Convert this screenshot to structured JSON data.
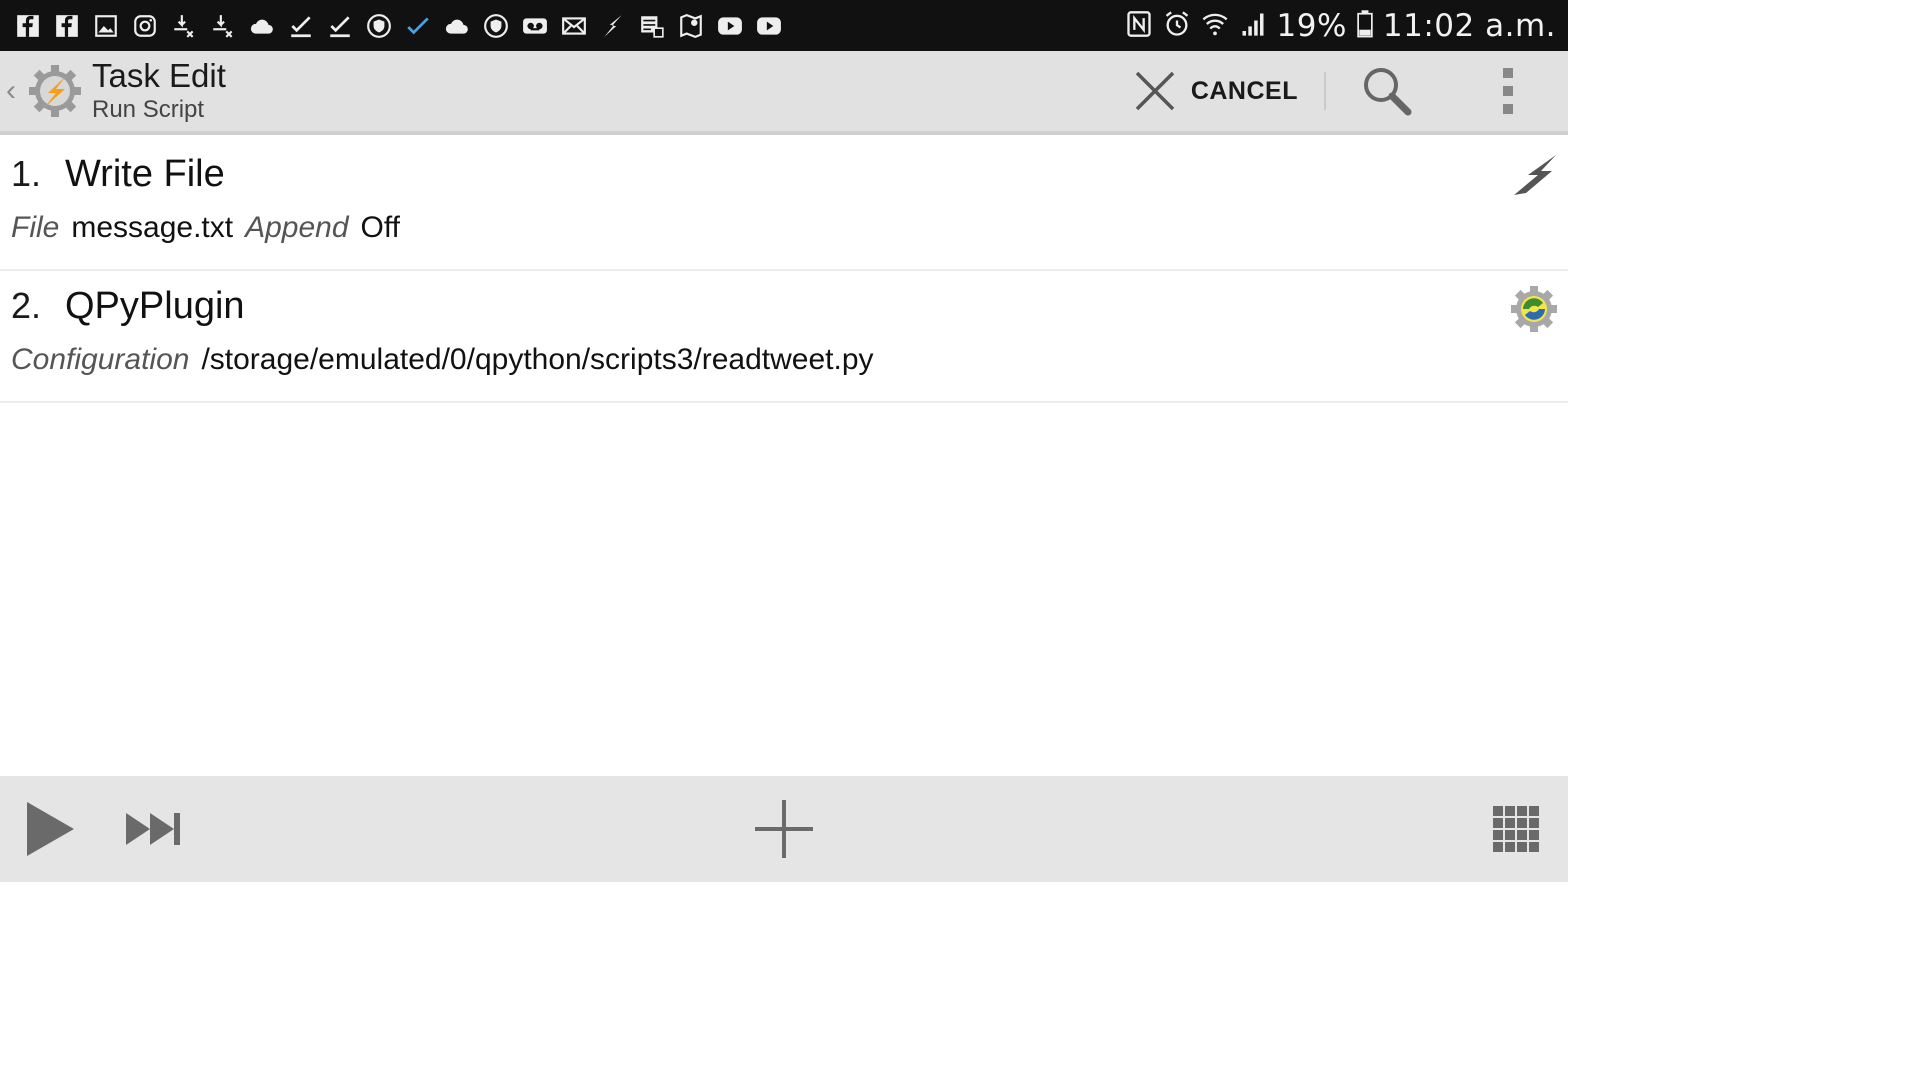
{
  "status_bar": {
    "notification_icons": [
      "facebook-icon",
      "facebook-icon",
      "gallery-icon",
      "instagram-icon",
      "download-done-icon",
      "download-done-icon",
      "cloud-icon",
      "checkmark-icon",
      "checkmark-icon",
      "shield-icon",
      "check-blue-icon",
      "cloud-icon",
      "shield-icon",
      "voicemail-icon",
      "mail-icon",
      "tasker-bolt-icon",
      "news-icon",
      "map-icon",
      "youtube-icon",
      "youtube-icon"
    ],
    "battery": "19%",
    "time": "11:02 a.m."
  },
  "app_bar": {
    "title": "Task Edit",
    "subtitle": "Run Script",
    "cancel_label": "CANCEL"
  },
  "actions": [
    {
      "number": "1.",
      "name": "Write File",
      "params": [
        {
          "key": "File",
          "value": "message.txt"
        },
        {
          "key": "Append",
          "value": "Off"
        }
      ],
      "icon": "tasker-bolt-icon"
    },
    {
      "number": "2.",
      "name": "QPyPlugin",
      "params": [
        {
          "key": "Configuration",
          "value": "/storage/emulated/0/qpython/scripts3/readtweet.py"
        }
      ],
      "icon": "qpython-plugin-icon"
    }
  ],
  "bottom_bar": {
    "buttons": [
      "play-icon",
      "step-forward-icon",
      "add-icon",
      "grid-icon"
    ]
  },
  "colors": {
    "status_bar_bg": "#111111",
    "app_bar_bg": "#e1e1e1",
    "bottom_bar_bg": "#e5e5e5",
    "accent_orange": "#f6a019"
  }
}
